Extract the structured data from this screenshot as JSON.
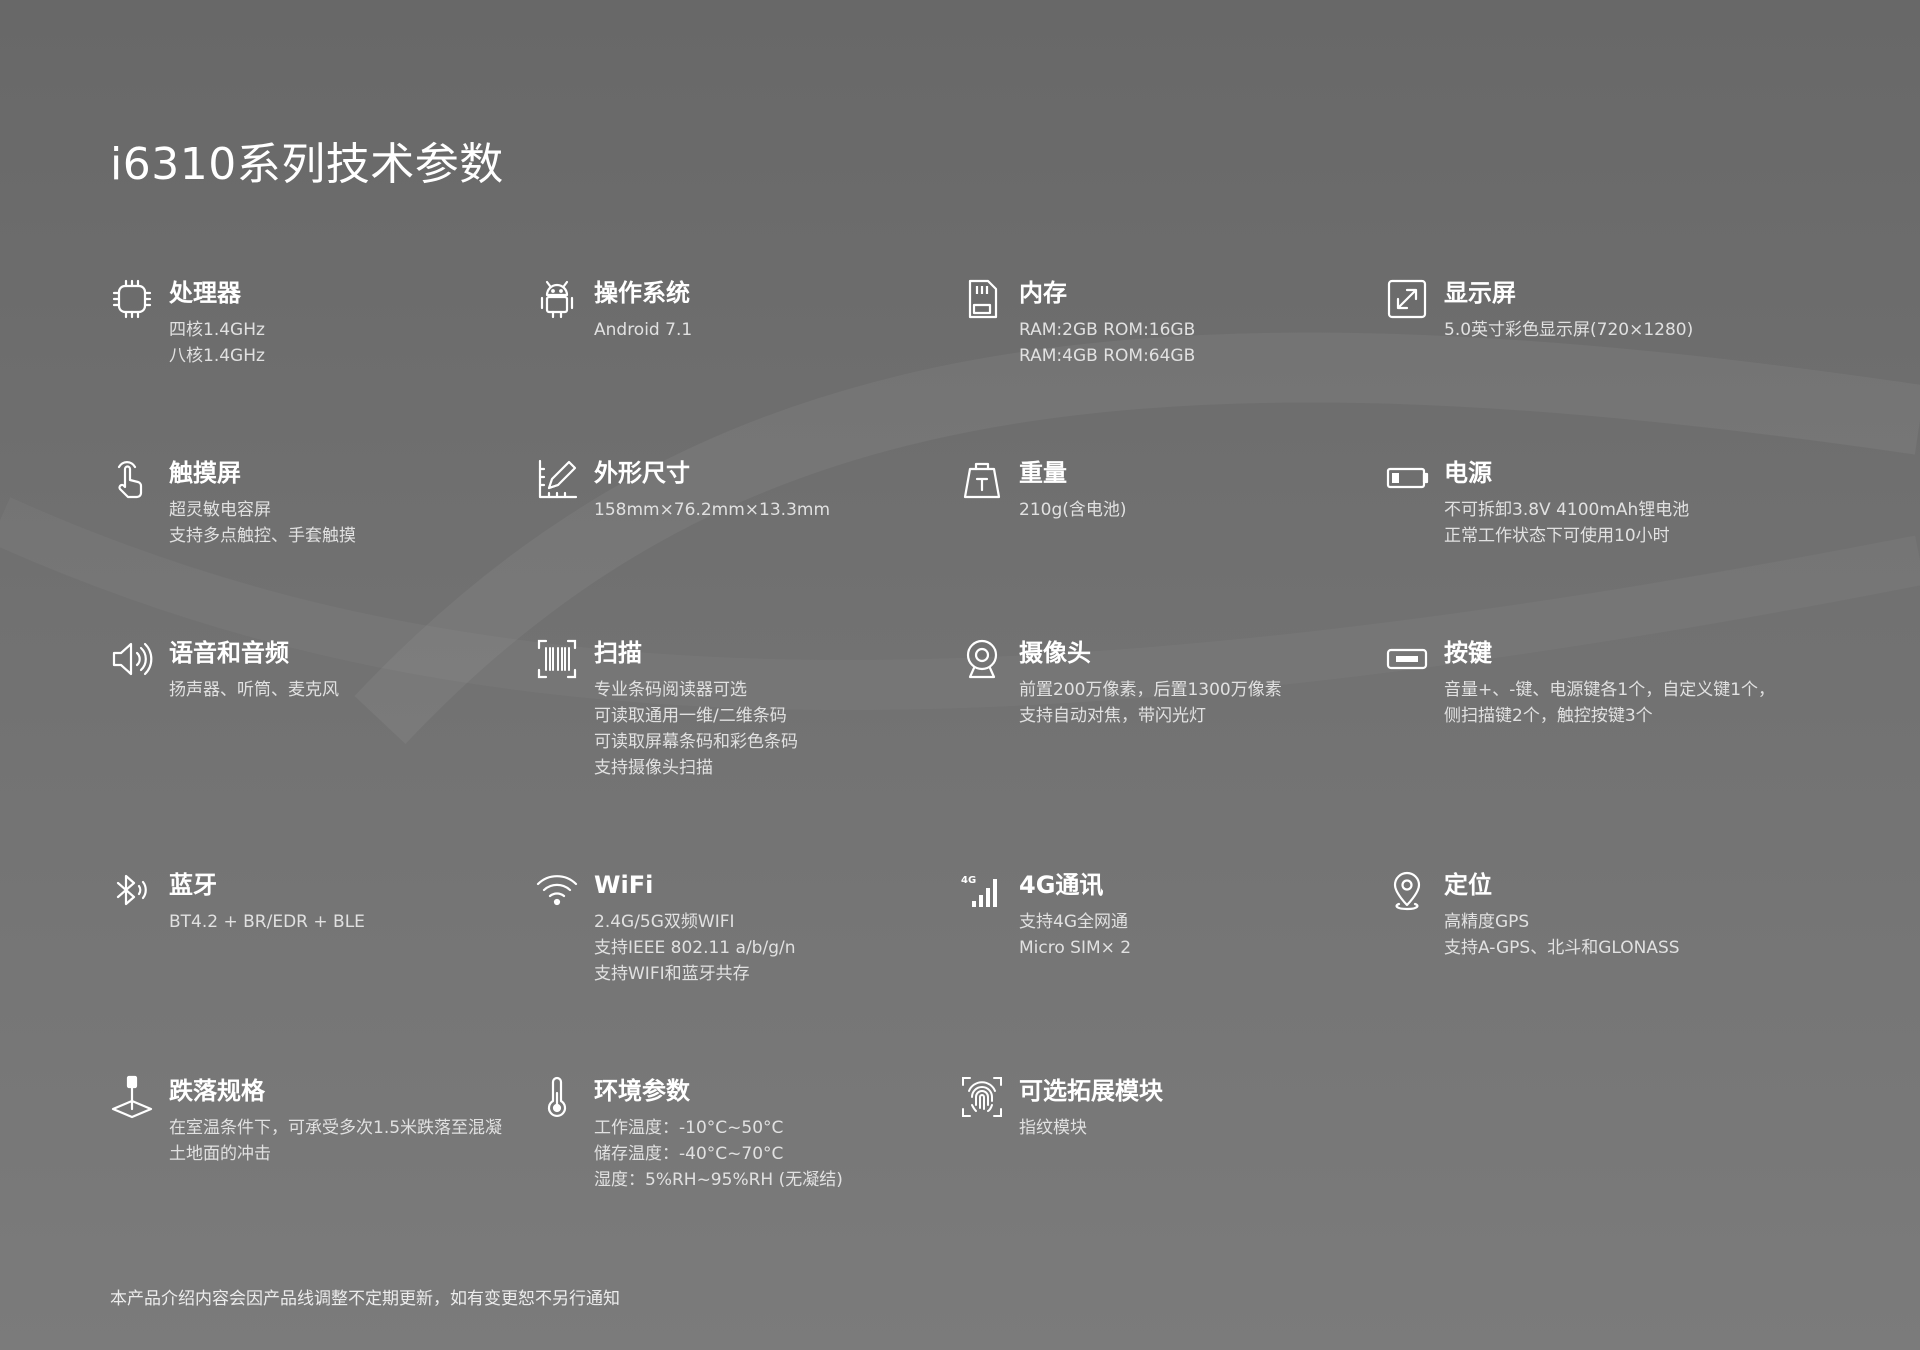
{
  "page_title": "i6310系列技术参数",
  "specs": [
    {
      "name": "处理器",
      "icon": "chip-icon",
      "lines": [
        "四核1.4GHz",
        "八核1.4GHz"
      ]
    },
    {
      "name": "操作系统",
      "icon": "android-icon",
      "lines": [
        "Android 7.1"
      ]
    },
    {
      "name": "内存",
      "icon": "memory-card-icon",
      "lines": [
        "RAM:2GB ROM:16GB",
        "RAM:4GB ROM:64GB"
      ]
    },
    {
      "name": "显示屏",
      "icon": "expand-screen-icon",
      "lines": [
        "5.0英寸彩色显示屏(720×1280)"
      ]
    },
    {
      "name": "触摸屏",
      "icon": "touch-hand-icon",
      "lines": [
        "超灵敏电容屏",
        "支持多点触控、手套触摸"
      ]
    },
    {
      "name": "外形尺寸",
      "icon": "ruler-pencil-icon",
      "lines": [
        "158mm×76.2mm×13.3mm"
      ]
    },
    {
      "name": "重量",
      "icon": "weight-icon",
      "lines": [
        "210g(含电池)"
      ]
    },
    {
      "name": "电源",
      "icon": "battery-icon",
      "lines": [
        "不可拆卸3.8V 4100mAh锂电池",
        "正常工作状态下可使用10小时"
      ]
    },
    {
      "name": "语音和音频",
      "icon": "speaker-icon",
      "lines": [
        "扬声器、听筒、麦克风"
      ]
    },
    {
      "name": "扫描",
      "icon": "barcode-scan-icon",
      "lines": [
        "专业条码阅读器可选",
        "可读取通用一维/二维条码",
        "可读取屏幕条码和彩色条码",
        "支持摄像头扫描"
      ]
    },
    {
      "name": "摄像头",
      "icon": "webcam-icon",
      "lines": [
        "前置200万像素，后置1300万像素",
        "支持自动对焦，带闪光灯"
      ]
    },
    {
      "name": "按键",
      "icon": "key-button-icon",
      "lines": [
        "音量+、-键、电源键各1个，自定义键1个，",
        "侧扫描键2个，触控按键3个"
      ]
    },
    {
      "name": "蓝牙",
      "icon": "bluetooth-icon",
      "lines": [
        "BT4.2 + BR/EDR + BLE"
      ]
    },
    {
      "name": "WiFi",
      "icon": "wifi-icon",
      "lines": [
        "2.4G/5G双频WIFI",
        "支持IEEE 802.11 a/b/g/n",
        "支持WIFI和蓝牙共存"
      ]
    },
    {
      "name": "4G通讯",
      "icon": "signal-4g-icon",
      "lines": [
        "支持4G全网通",
        "Micro SIM× 2"
      ]
    },
    {
      "name": "定位",
      "icon": "location-pin-icon",
      "lines": [
        "高精度GPS",
        "支持A-GPS、北斗和GLONASS"
      ]
    },
    {
      "name": "跌落规格",
      "icon": "drop-test-icon",
      "lines": [
        "在室温条件下，可承受多次1.5米跌落至混凝土地面的冲击"
      ]
    },
    {
      "name": "环境参数",
      "icon": "thermometer-icon",
      "lines": [
        "工作温度：-10°C~50°C",
        "储存温度：-40°C~70°C",
        "湿度：5%RH~95%RH (无凝结)"
      ]
    },
    {
      "name": "可选拓展模块",
      "icon": "fingerprint-icon",
      "lines": [
        "指纹模块"
      ]
    }
  ],
  "footer_note": "本产品介绍内容会因产品线调整不定期更新，如有变更恕不另行通知"
}
